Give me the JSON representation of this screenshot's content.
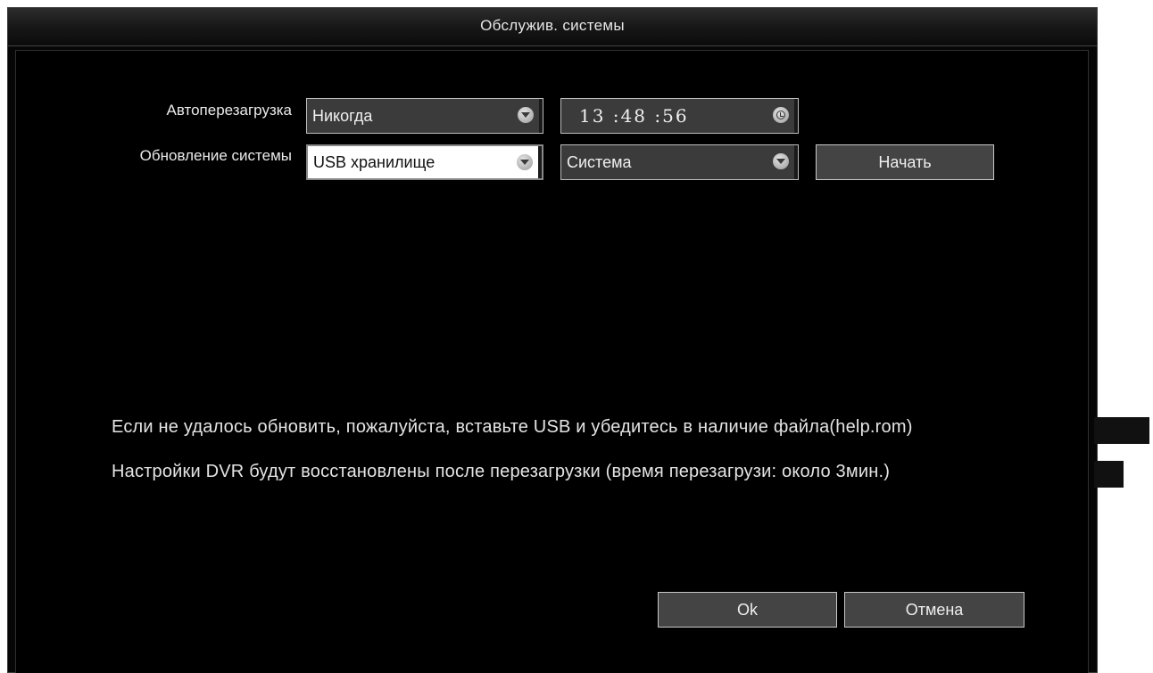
{
  "window": {
    "title": "Обслужив. системы"
  },
  "auto_reboot": {
    "label": "Автоперезагрузка",
    "value": "Никогда",
    "time": "13 :48 :56"
  },
  "system_update": {
    "label": "Обновление системы",
    "source": "USB хранилище",
    "target": "Система",
    "start_button": "Начать"
  },
  "notes": {
    "line1": "Если не удалось обновить, пожалуйста, вставьте USB и убедитесь в наличие файла(help.rom)",
    "line2": "Настройки DVR будут восстановлены после перезагрузки (время перезагрузи: около 3мин.)"
  },
  "buttons": {
    "ok": "Ok",
    "cancel": "Отмена"
  }
}
